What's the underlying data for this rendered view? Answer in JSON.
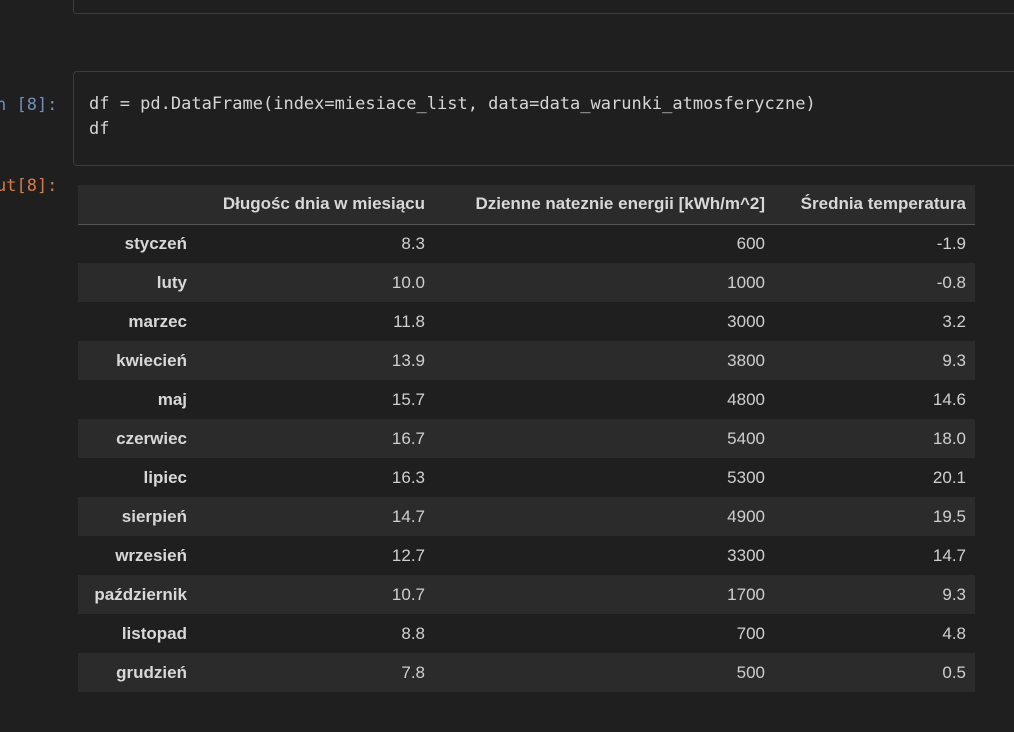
{
  "cells": {
    "input_prompt": "n [8]:",
    "output_prompt": "ut[8]:",
    "code": {
      "line1": "df = pd.DataFrame(index=miesiace_list, data=data_warunki_atmosferyczne)",
      "line2": "df"
    }
  },
  "table": {
    "columns": [
      "Długośc dnia w miesiącu",
      "Dzienne nateznie energii [kWh/m^2]",
      "Średnia temperatura"
    ],
    "rows": [
      {
        "index": "styczeń",
        "a": "8.3",
        "b": "600",
        "c": "-1.9"
      },
      {
        "index": "luty",
        "a": "10.0",
        "b": "1000",
        "c": "-0.8"
      },
      {
        "index": "marzec",
        "a": "11.8",
        "b": "3000",
        "c": "3.2"
      },
      {
        "index": "kwiecień",
        "a": "13.9",
        "b": "3800",
        "c": "9.3"
      },
      {
        "index": "maj",
        "a": "15.7",
        "b": "4800",
        "c": "14.6"
      },
      {
        "index": "czerwiec",
        "a": "16.7",
        "b": "5400",
        "c": "18.0"
      },
      {
        "index": "lipiec",
        "a": "16.3",
        "b": "5300",
        "c": "20.1"
      },
      {
        "index": "sierpień",
        "a": "14.7",
        "b": "4900",
        "c": "19.5"
      },
      {
        "index": "wrzesień",
        "a": "12.7",
        "b": "3300",
        "c": "14.7"
      },
      {
        "index": "październik",
        "a": "10.7",
        "b": "1700",
        "c": "9.3"
      },
      {
        "index": "listopad",
        "a": "8.8",
        "b": "700",
        "c": "4.8"
      },
      {
        "index": "grudzień",
        "a": "7.8",
        "b": "500",
        "c": "0.5"
      }
    ]
  },
  "colors": {
    "background": "#1f1f1f",
    "stripe": "#2b2b2b",
    "input_prompt": "#6f8fbf",
    "output_prompt": "#d77a4a"
  }
}
